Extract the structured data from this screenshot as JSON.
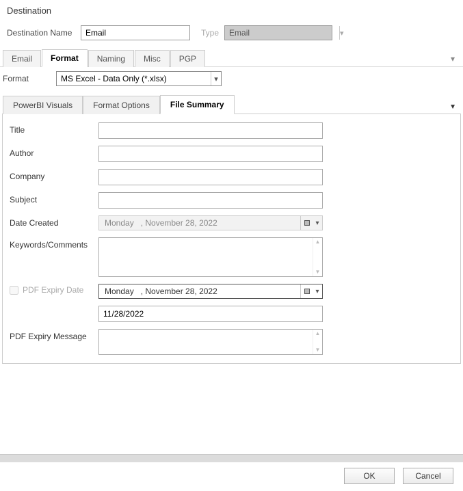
{
  "window": {
    "title": "Destination"
  },
  "header": {
    "name_label": "Destination Name",
    "name_value": "Email",
    "type_label": "Type",
    "type_value": "Email"
  },
  "tabs": {
    "items": [
      "Email",
      "Format",
      "Naming",
      "Misc",
      "PGP"
    ],
    "active_index": 1
  },
  "format": {
    "label": "Format",
    "value": "MS Excel - Data Only (*.xlsx)"
  },
  "subtabs": {
    "items": [
      "PowerBI Visuals",
      "Format Options",
      "File Summary"
    ],
    "active_index": 2
  },
  "file_summary": {
    "title_label": "Title",
    "title_value": "",
    "author_label": "Author",
    "author_value": "",
    "company_label": "Company",
    "company_value": "",
    "subject_label": "Subject",
    "subject_value": "",
    "date_created_label": "Date Created",
    "date_created_value": "Monday   , November 28, 2022",
    "keywords_label": "Keywords/Comments",
    "keywords_value": "",
    "pdf_expiry_checkbox_label": "PDF Expiry Date",
    "pdf_expiry_date_value": "Monday   , November 28, 2022",
    "pdf_expiry_short_value": "11/28/2022",
    "pdf_expiry_message_label": "PDF Expiry Message",
    "pdf_expiry_message_value": ""
  },
  "buttons": {
    "ok": "OK",
    "cancel": "Cancel"
  }
}
